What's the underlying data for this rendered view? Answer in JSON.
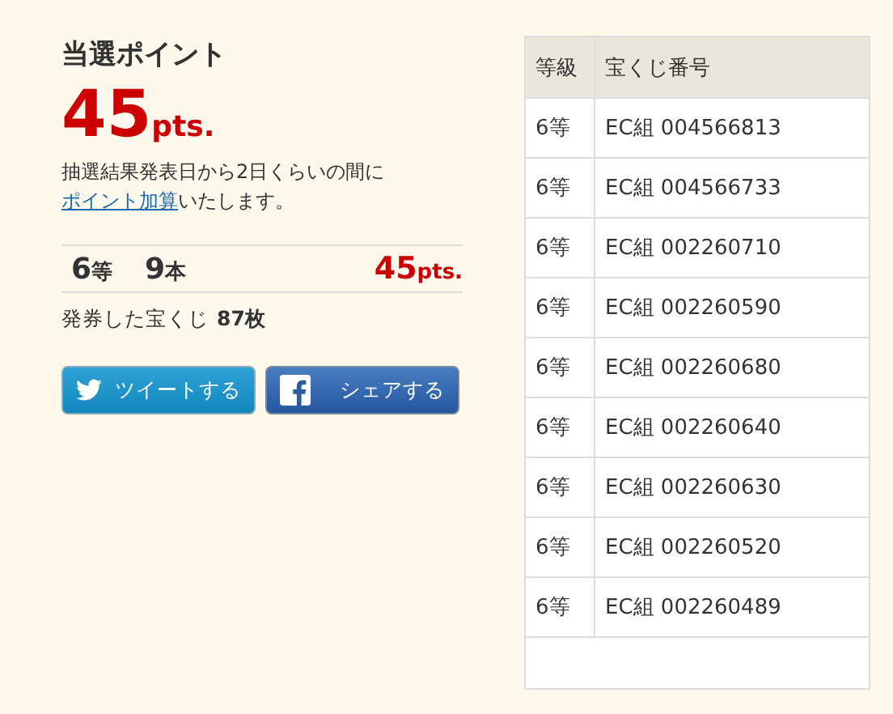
{
  "points": {
    "title": "当選ポイント",
    "value": "45",
    "unit": "pts.",
    "note_before": "抽選結果発表日から2日くらいの間に",
    "note_link": "ポイント加算",
    "note_after": "いたします。"
  },
  "summary": {
    "grade": "6",
    "grade_unit": "等",
    "count": "9",
    "count_unit": "本",
    "points": "45",
    "points_unit": "pts."
  },
  "issued": {
    "label": "発券した宝くじ",
    "value": "87枚"
  },
  "buttons": [
    {
      "kind": "twitter",
      "label": "ツイートする"
    },
    {
      "kind": "facebook",
      "label": "シェアする"
    }
  ],
  "table": {
    "columns": [
      "等級",
      "宝くじ番号"
    ],
    "rows": [
      [
        "6等",
        "EC組 004566813"
      ],
      [
        "6等",
        "EC組 004566733"
      ],
      [
        "6等",
        "EC組 002260710"
      ],
      [
        "6等",
        "EC組 002260590"
      ],
      [
        "6等",
        "EC組 002260680"
      ],
      [
        "6等",
        "EC組 002260640"
      ],
      [
        "6等",
        "EC組 002260630"
      ],
      [
        "6等",
        "EC組 002260520"
      ],
      [
        "6等",
        "EC組 002260489"
      ]
    ]
  }
}
